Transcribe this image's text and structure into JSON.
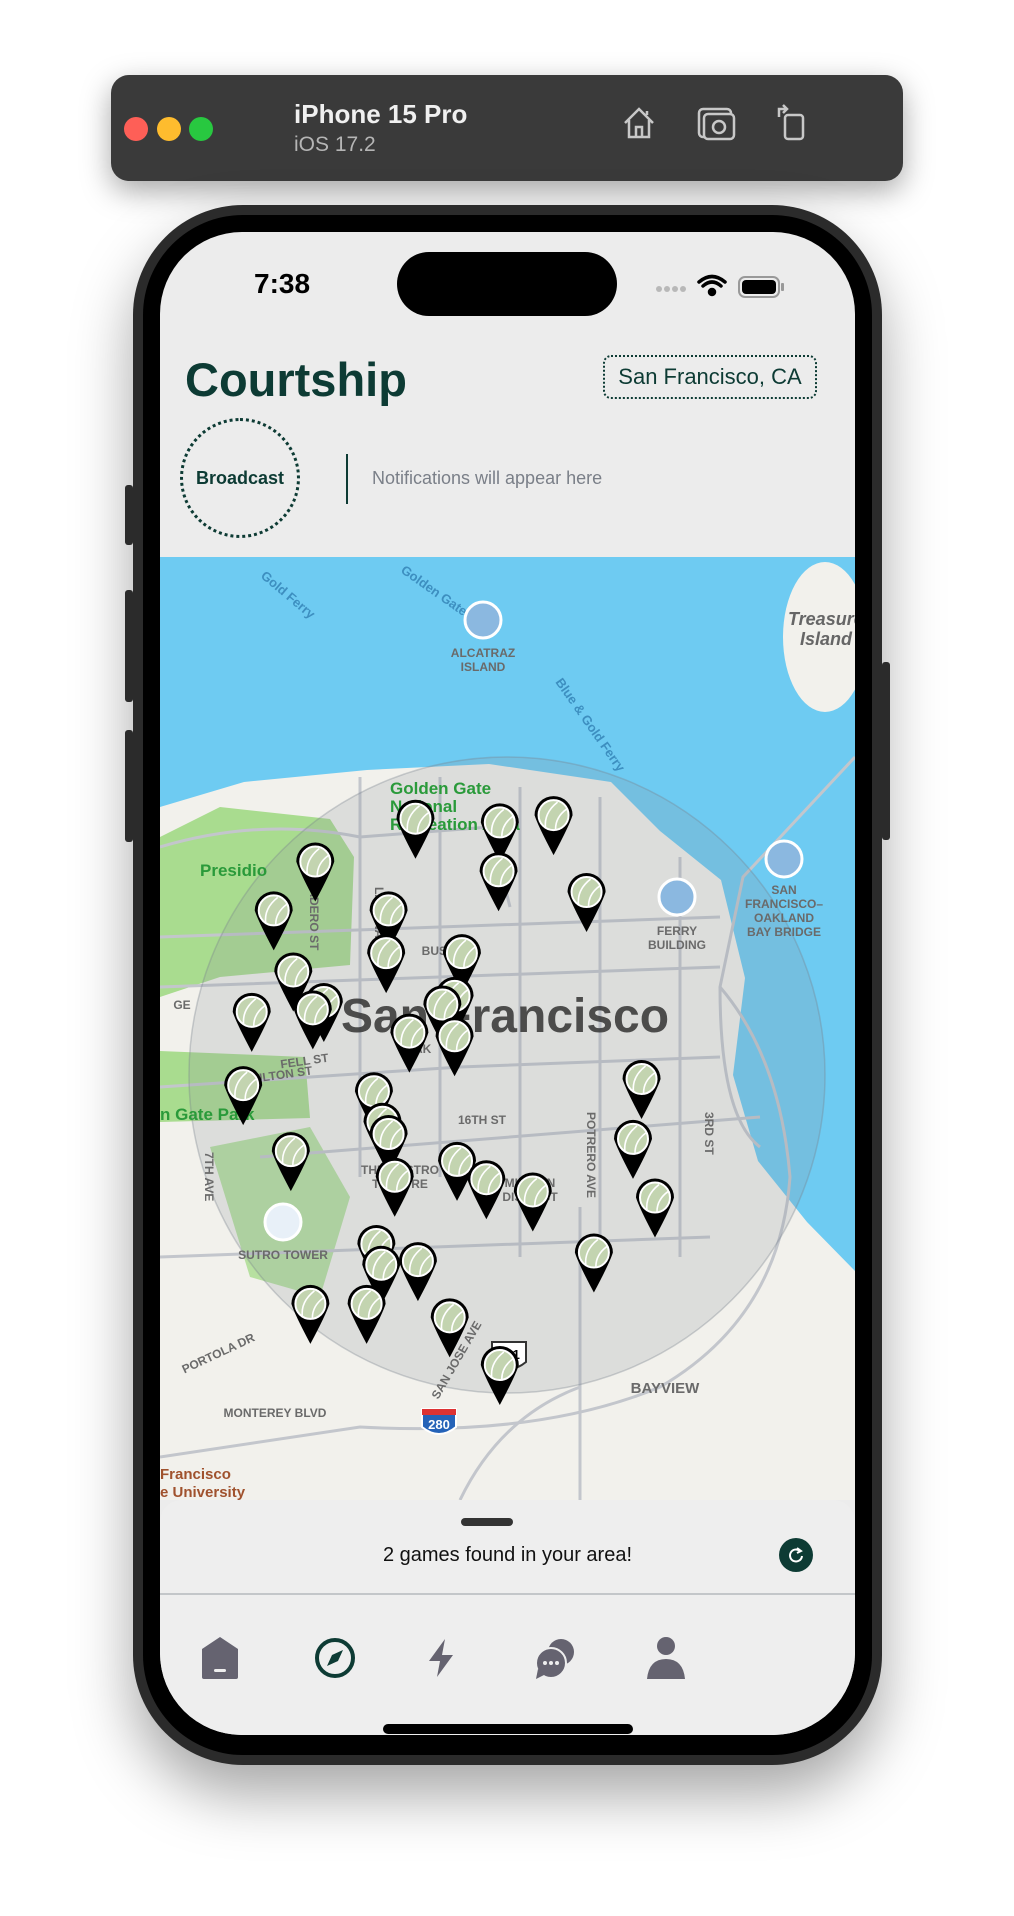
{
  "simulator": {
    "device": "iPhone 15 Pro",
    "os": "iOS 17.2",
    "icons": [
      "home-icon",
      "screenshot-icon",
      "rotate-icon"
    ]
  },
  "status_bar": {
    "time": "7:38",
    "icons": [
      "signal-icon",
      "wifi-icon",
      "battery-icon"
    ]
  },
  "header": {
    "title": "Courtship",
    "location": "San Francisco, CA"
  },
  "broadcast": {
    "label": "Broadcast",
    "notification_text": "Notifications will appear here"
  },
  "map": {
    "labels": {
      "ferry1": "Gold Ferry",
      "ferry2": "Golden Gate Ferry",
      "ferry3": "Blue & Gold Ferry",
      "alcatraz1": "ALCATRAZ",
      "alcatraz2": "ISLAND",
      "treasure1": "Treasure",
      "treasure2": "Island",
      "ggnra1": "Golden Gate",
      "ggnra2": "National",
      "ggnra3": "Recreation Area",
      "presidio": "Presidio",
      "divisadero": "DIVISADERO ST",
      "laguna": "LAGUNA",
      "bush": "BUSH ST",
      "ferrybldg1": "FERRY",
      "ferrybldg2": "BUILDING",
      "bridge1": "SAN",
      "bridge2": "FRANCISCO–",
      "bridge3": "OAKLAND",
      "bridge4": "BAY BRIDGE",
      "city": "San Francisco",
      "geary": "GE",
      "fulton": "FULTON ST",
      "fell": "FELL ST",
      "oak": "OAK",
      "ggpark": "n Gate Park",
      "sixteenth": "16TH ST",
      "potrero": "POTRERO AVE",
      "third": "3RD ST",
      "seventh": "7TH AVE",
      "castro1": "THE CASTRO",
      "castro2": "THEATRE",
      "mission1": "MISSION",
      "mission2": "DISTRICT",
      "sutro": "SUTRO TOWER",
      "portola": "PORTOLA DR",
      "sanjose": "SAN JOSE AVE",
      "monterey": "MONTEREY BLVD",
      "bayview": "BAYVIEW",
      "hwy101": "101",
      "hwy280": "280",
      "sfsu1": "Francisco",
      "sfsu2": "e University"
    },
    "pin_icon": "tennis-ball-pin-icon",
    "colors": {
      "water": "#6ecbf2",
      "land": "#f2f1ec",
      "park": "#a9dc8f",
      "pin": "#000000",
      "ball": "#c3d4b0",
      "radius": "rgba(140,150,160,0.22)"
    }
  },
  "sheet": {
    "message": "2 games found in your area!",
    "refresh_icon": "refresh-icon"
  },
  "tabs": [
    {
      "name": "home",
      "icon": "home-icon",
      "active": false
    },
    {
      "name": "explore",
      "icon": "compass-icon",
      "active": true
    },
    {
      "name": "activity",
      "icon": "lightning-icon",
      "active": false
    },
    {
      "name": "messages",
      "icon": "chat-bubbles-icon",
      "active": false
    },
    {
      "name": "profile",
      "icon": "person-icon",
      "active": false
    }
  ],
  "colors": {
    "brand": "#0d3b34",
    "inactive_tab": "#656370",
    "background": "#ececec"
  }
}
